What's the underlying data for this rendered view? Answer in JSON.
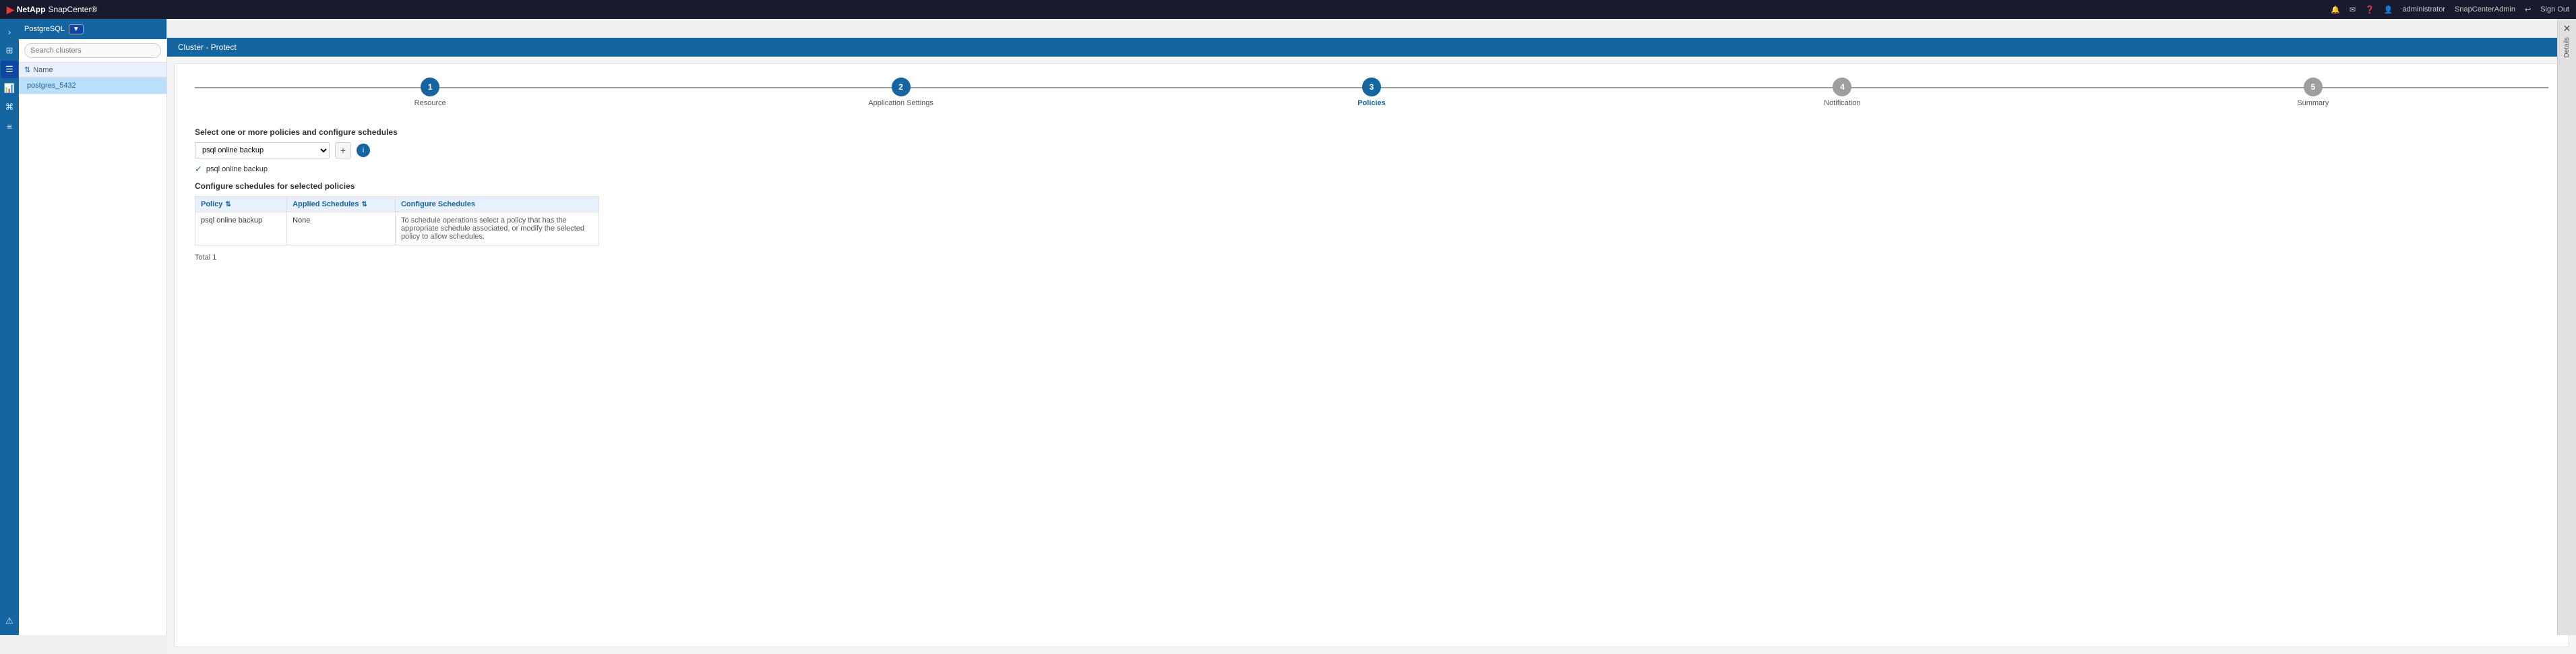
{
  "app": {
    "logo_text": "NetApp",
    "app_name": "SnapCenter®"
  },
  "topbar": {
    "notification_icon": "🔔",
    "mail_icon": "✉",
    "help_icon": "?",
    "user_icon": "👤",
    "user_label": "administrator",
    "admin_label": "SnapCenterAdmin",
    "signout_label": "Sign Out"
  },
  "cluster_sidebar": {
    "title": "PostgreSQL",
    "pill_label": "▼",
    "search_placeholder": "Search clusters",
    "columns": [
      {
        "label": "Name"
      }
    ],
    "clusters": [
      {
        "name": "postgres_5432",
        "selected": true
      }
    ]
  },
  "breadcrumb": {
    "text": "Cluster - Protect"
  },
  "wizard": {
    "steps": [
      {
        "number": "1",
        "label": "Resource",
        "state": "completed"
      },
      {
        "number": "2",
        "label": "Application Settings",
        "state": "completed"
      },
      {
        "number": "3",
        "label": "Policies",
        "state": "active"
      },
      {
        "number": "4",
        "label": "Notification",
        "state": "inactive"
      },
      {
        "number": "5",
        "label": "Summary",
        "state": "inactive"
      }
    ],
    "policy_section": {
      "title": "Select one or more policies and configure schedules",
      "dropdown_value": "psql online backup",
      "add_tooltip": "+",
      "info_tooltip": "i",
      "checked_policy": "psql online backup"
    },
    "schedule_section": {
      "title": "Configure schedules for selected policies",
      "table": {
        "columns": [
          {
            "label": "Policy"
          },
          {
            "label": "Applied Schedules"
          },
          {
            "label": "Configure Schedules"
          }
        ],
        "rows": [
          {
            "policy": "psql online backup",
            "applied_schedules": "None",
            "configure_schedules": "To schedule operations select a policy that has the appropriate schedule associated, or modify the selected policy to allow schedules."
          }
        ]
      },
      "total_text": "Total 1"
    }
  },
  "details_panel": {
    "label": "Details"
  }
}
